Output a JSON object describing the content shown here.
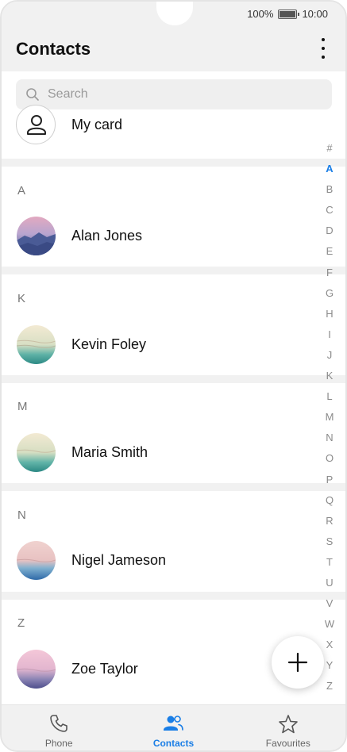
{
  "status_bar": {
    "battery_percent": "100%",
    "time": "10:00"
  },
  "header": {
    "title": "Contacts",
    "more_icon": "more-vert-icon"
  },
  "search": {
    "placeholder": "Search"
  },
  "my_card": {
    "label": "My card"
  },
  "sections": [
    {
      "letter": "A",
      "contacts": [
        {
          "name": "Alan Jones",
          "avatar": "mountain-dusk"
        }
      ]
    },
    {
      "letter": "K",
      "contacts": [
        {
          "name": "Kevin Foley",
          "avatar": "sea-cream"
        }
      ]
    },
    {
      "letter": "M",
      "contacts": [
        {
          "name": "Maria Smith",
          "avatar": "sea-cream"
        }
      ]
    },
    {
      "letter": "N",
      "contacts": [
        {
          "name": "Nigel Jameson",
          "avatar": "sea-pink"
        }
      ]
    },
    {
      "letter": "Z",
      "contacts": [
        {
          "name": "Zoe Taylor",
          "avatar": "pink-dusk"
        }
      ]
    }
  ],
  "alphabet_index": [
    "#",
    "A",
    "B",
    "C",
    "D",
    "E",
    "F",
    "G",
    "H",
    "I",
    "J",
    "K",
    "L",
    "M",
    "N",
    "O",
    "P",
    "Q",
    "R",
    "S",
    "T",
    "U",
    "V",
    "W",
    "X",
    "Y",
    "Z"
  ],
  "alphabet_active": "A",
  "fab": {
    "icon": "plus-icon"
  },
  "bottom_nav": [
    {
      "label": "Phone",
      "icon": "phone-icon",
      "active": false
    },
    {
      "label": "Contacts",
      "icon": "people-icon",
      "active": true
    },
    {
      "label": "Favourites",
      "icon": "star-icon",
      "active": false
    }
  ],
  "colors": {
    "accent": "#1a7ee6",
    "background": "#ffffff",
    "bar": "#f1f1f1"
  }
}
